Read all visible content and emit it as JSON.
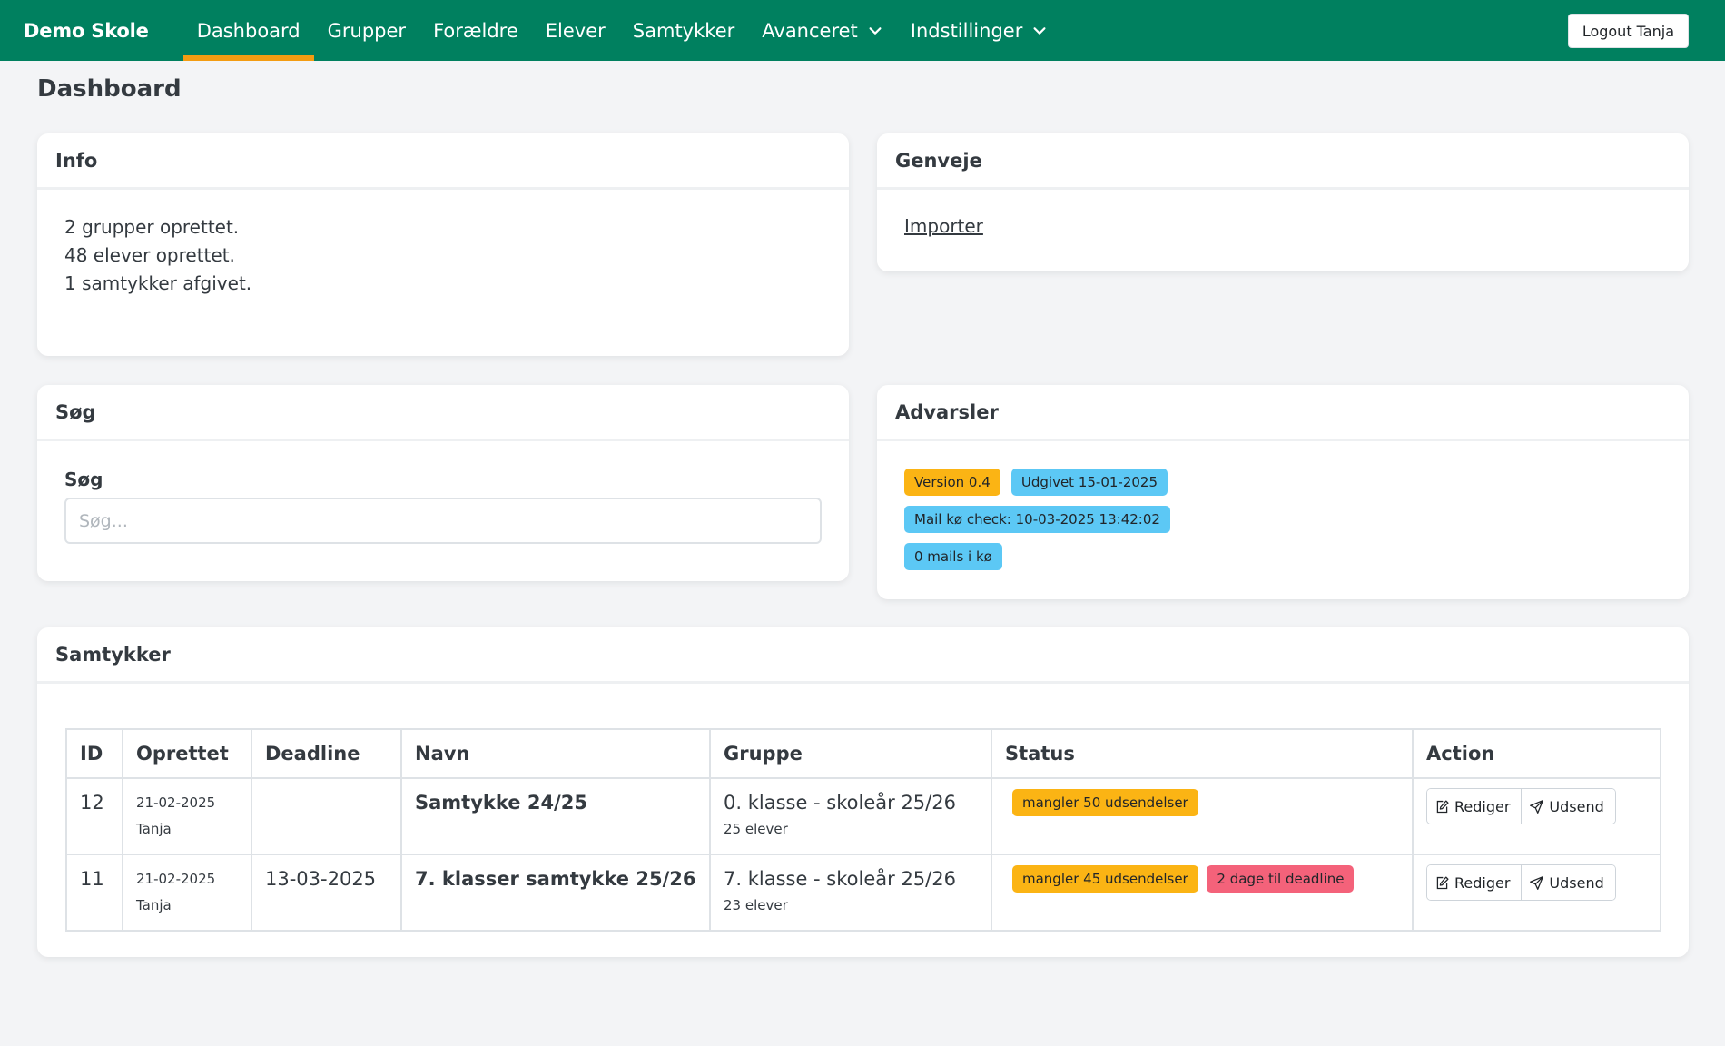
{
  "nav": {
    "brand": "Demo Skole",
    "items": [
      {
        "label": "Dashboard",
        "active": true
      },
      {
        "label": "Grupper"
      },
      {
        "label": "Forældre"
      },
      {
        "label": "Elever"
      },
      {
        "label": "Samtykker"
      },
      {
        "label": "Avanceret",
        "dropdown": true
      },
      {
        "label": "Indstillinger",
        "dropdown": true
      }
    ],
    "logout": "Logout Tanja"
  },
  "page_title": "Dashboard",
  "info": {
    "title": "Info",
    "lines": [
      "2 grupper oprettet.",
      "48 elever oprettet.",
      "1 samtykker afgivet."
    ]
  },
  "shortcuts": {
    "title": "Genveje",
    "link": "Importer"
  },
  "search": {
    "title": "Søg",
    "label": "Søg",
    "placeholder": "Søg..."
  },
  "warnings": {
    "title": "Advarsler",
    "badges": [
      {
        "text": "Version 0.4",
        "color": "#fbb414"
      },
      {
        "text": "Udgivet 15-01-2025",
        "color": "#5cc8f5"
      },
      {
        "text": "Mail kø check: 10-03-2025 13:42:02",
        "color": "#5cc8f5"
      },
      {
        "text": "0 mails i kø",
        "color": "#5cc8f5"
      }
    ]
  },
  "consents": {
    "title": "Samtykker",
    "columns": [
      "ID",
      "Oprettet",
      "Deadline",
      "Navn",
      "Gruppe",
      "Status",
      "Action"
    ],
    "rows": [
      {
        "id": "12",
        "created_date": "21-02-2025",
        "created_by": "Tanja",
        "deadline": "",
        "name": "Samtykke 24/25",
        "group": "0. klasse - skoleår 25/26",
        "group_count": "25 elever",
        "status": [
          {
            "text": "mangler 50 udsendelser",
            "color": "#fbb414"
          }
        ]
      },
      {
        "id": "11",
        "created_date": "21-02-2025",
        "created_by": "Tanja",
        "deadline": "13-03-2025",
        "name": "7. klasser samtykke 25/26",
        "group": "7. klasse - skoleår 25/26",
        "group_count": "23 elever",
        "status": [
          {
            "text": "mangler 45 udsendelser",
            "color": "#fbb414"
          },
          {
            "text": "2 dage til deadline",
            "color": "#f4627a"
          }
        ]
      }
    ],
    "actions": {
      "edit": "Rediger",
      "send": "Udsend"
    }
  },
  "colors": {
    "navbar": "#00805f",
    "active_underline": "#f39c12"
  }
}
